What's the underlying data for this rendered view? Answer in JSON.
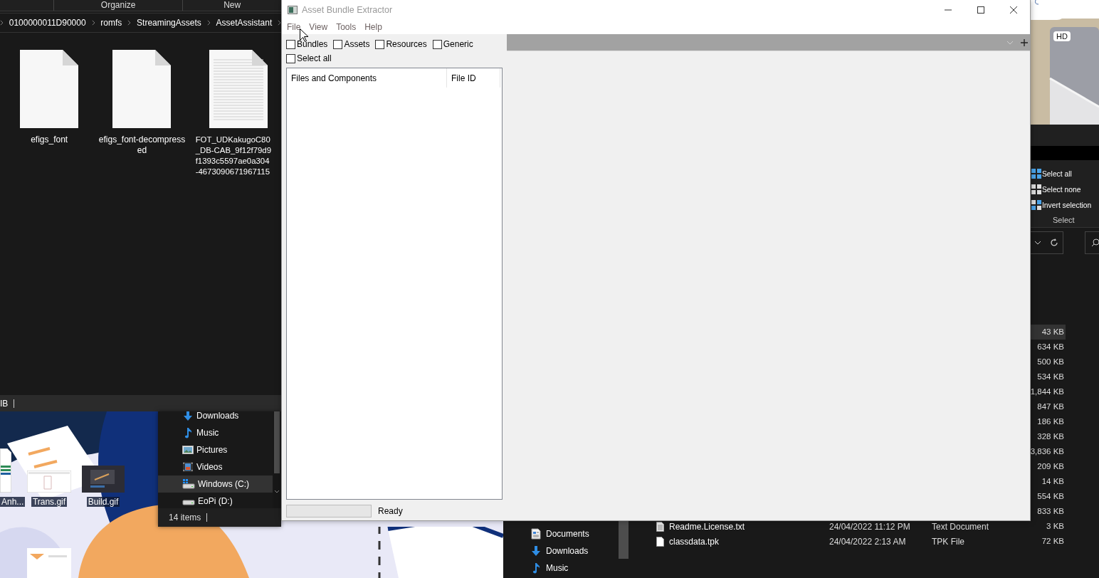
{
  "explorer_back": {
    "ribbon_groups": [
      "Organize",
      "New"
    ],
    "breadcrumb": [
      "0100000011D90000",
      "romfs",
      "StreamingAssets",
      "AssetAssistant"
    ],
    "files": [
      {
        "kind": "blank",
        "name_lines": [
          "efigs_font"
        ]
      },
      {
        "kind": "blank",
        "name_lines": [
          "efigs_font-decompress",
          "ed"
        ]
      },
      {
        "kind": "text",
        "name_lines": [
          "FOT_UDKakugoC80",
          "_DB-CAB_9f12f79d9",
          "f1393c5597ae0a304",
          "-4673090671967115"
        ]
      }
    ],
    "status": "IB"
  },
  "desktop": {
    "icons": [
      {
        "kind": "sheet",
        "label": "Anh..."
      },
      {
        "kind": "light",
        "label": "Trans.gif"
      },
      {
        "kind": "dark",
        "label": "Build.gif"
      }
    ]
  },
  "nav_window": {
    "items": [
      {
        "kind": "download",
        "label": "Downloads",
        "selected": false
      },
      {
        "kind": "music",
        "label": "Music",
        "selected": false
      },
      {
        "kind": "pictures",
        "label": "Pictures",
        "selected": false
      },
      {
        "kind": "videos",
        "label": "Videos",
        "selected": false
      },
      {
        "kind": "system-drive",
        "label": "Windows (C:)",
        "selected": true
      },
      {
        "kind": "drive",
        "label": "EoPi (D:)",
        "selected": false
      }
    ],
    "status": "14 items"
  },
  "browser_tile": {
    "badge": "HD"
  },
  "right_explorer": {
    "select_actions": [
      {
        "kind": "all",
        "label": "Select all"
      },
      {
        "kind": "none",
        "label": "Select none"
      },
      {
        "kind": "invert",
        "label": "Invert selection"
      }
    ],
    "group_label": "Select",
    "rows": [
      {
        "size": "43 KB",
        "selected": true
      },
      {
        "size": "634 KB",
        "selected": false
      },
      {
        "size": "500 KB",
        "selected": false
      },
      {
        "size": "534 KB",
        "selected": false
      },
      {
        "size": "1,844 KB",
        "selected": false
      },
      {
        "size": "847 KB",
        "selected": false
      },
      {
        "size": "186 KB",
        "selected": false
      },
      {
        "size": "328 KB",
        "selected": false
      },
      {
        "size": "3,836 KB",
        "selected": false
      },
      {
        "size": "209 KB",
        "selected": false
      },
      {
        "size": "14 KB",
        "selected": false
      },
      {
        "size": "554 KB",
        "selected": false
      },
      {
        "size": "833 KB",
        "selected": false
      },
      {
        "kind": "text",
        "name": "Readme.License.txt",
        "date": "24/04/2022 11:12 PM",
        "type": "Text Document",
        "size": "3 KB",
        "selected": false
      },
      {
        "kind": "blank",
        "name": "classdata.tpk",
        "date": "24/04/2022 2:13 AM",
        "type": "TPK File",
        "size": "72 KB",
        "selected": false
      }
    ],
    "nav_items": [
      {
        "kind": "documents",
        "label": "Documents"
      },
      {
        "kind": "download",
        "label": "Downloads"
      },
      {
        "kind": "music",
        "label": "Music"
      }
    ]
  },
  "abe": {
    "title": "Asset Bundle Extractor",
    "menu": [
      "File",
      "View",
      "Tools",
      "Help"
    ],
    "filters": [
      {
        "label": "Bundles",
        "checked": false
      },
      {
        "label": "Assets",
        "checked": false
      },
      {
        "label": "Resources",
        "checked": false
      },
      {
        "label": "Generic",
        "checked": false
      }
    ],
    "select_all": {
      "label": "Select all",
      "checked": false
    },
    "tree_columns": [
      "Files and Components",
      "File ID"
    ],
    "progress": {
      "level": 0
    },
    "status": "Ready"
  }
}
